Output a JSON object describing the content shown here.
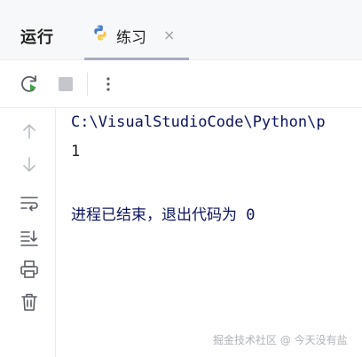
{
  "header": {
    "run_label": "运行",
    "tab": {
      "label": "练习",
      "close_symbol": "×"
    }
  },
  "toolbar": {
    "rerun_icon": "rerun-icon",
    "stop_icon": "stop-icon",
    "more_icon": "more-vertical-icon"
  },
  "side_toolbar": {
    "icons": [
      "arrow-up-icon",
      "arrow-down-icon",
      "soft-wrap-icon",
      "scroll-to-end-icon",
      "print-icon",
      "trash-icon"
    ]
  },
  "console": {
    "lines": [
      "C:\\VisualStudioCode\\Python\\p",
      "1",
      "",
      "进程已结束，退出代码为 0"
    ]
  },
  "watermark": "掘金技术社区 @ 今天没有盐",
  "colors": {
    "header_bg": "#f7f8fa",
    "console_text": "#0b1360",
    "python_blue": "#4a7bc8",
    "python_yellow": "#f2c94c",
    "rerun_green": "#3fa34d"
  }
}
